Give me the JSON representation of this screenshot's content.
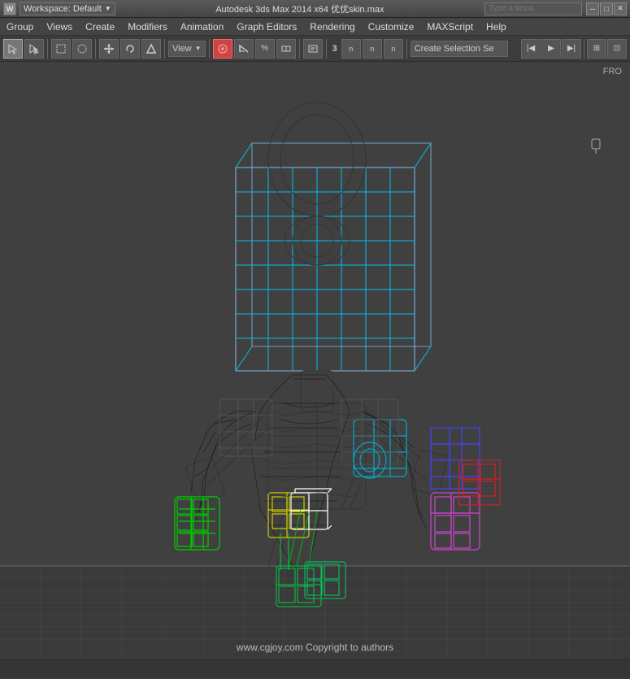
{
  "titlebar": {
    "icon_label": "W",
    "workspace_label": "Workspace: Default",
    "app_title": "Autodesk 3ds Max  2014 x64    优优skin.max",
    "search_placeholder": "Type a keyw",
    "win_min": "─",
    "win_max": "□",
    "win_close": "✕"
  },
  "menubar": {
    "items": [
      {
        "label": "Group"
      },
      {
        "label": "Views"
      },
      {
        "label": "Create"
      },
      {
        "label": "Modifiers"
      },
      {
        "label": "Animation"
      },
      {
        "label": "Graph Editors"
      },
      {
        "label": "Rendering"
      },
      {
        "label": "Customize"
      },
      {
        "label": "MAXScript"
      },
      {
        "label": "Help"
      }
    ]
  },
  "toolbar": {
    "view_dropdown": "View",
    "number_label": "3",
    "percent_label": "%",
    "selection_input": "Create Selection Se"
  },
  "viewport": {
    "label": "FRO",
    "watermark": "www.cgjoy.com  Copyright  to  authors"
  },
  "statusbar": {
    "text": ""
  }
}
